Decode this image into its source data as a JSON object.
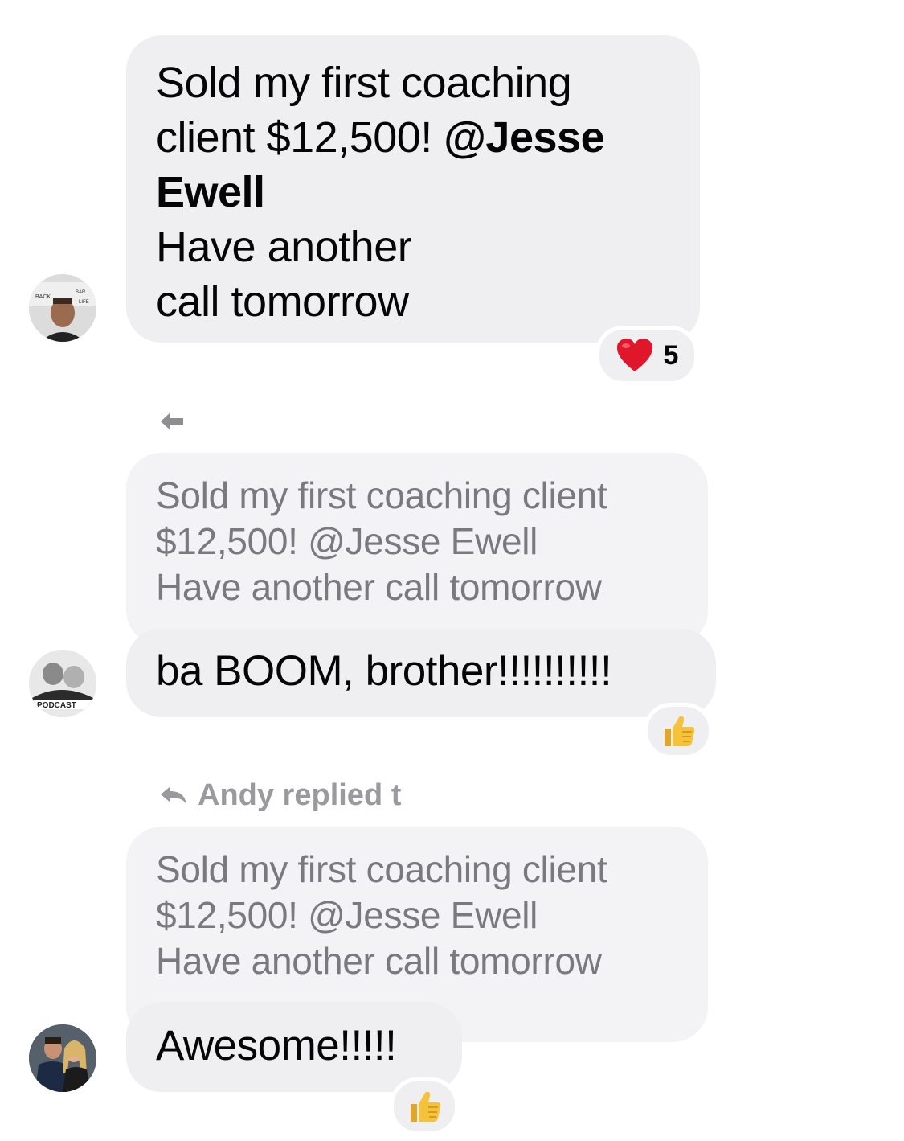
{
  "messages": [
    {
      "line1": "Sold my first coaching",
      "line2_pre": "client $12,500! ",
      "mention_part1": "@Jesse",
      "mention_part2": "Ewell",
      "line4": "Have another",
      "line5": "call tomorrow",
      "reaction_count": "5"
    },
    {
      "quote_line1": "Sold my first coaching client",
      "quote_line2": "$12,500! @Jesse Ewell",
      "quote_line3": "Have another call tomorrow",
      "text": "ba BOOM, brother!!!!!!!!!!"
    },
    {
      "reply_label": "Andy replied t",
      "quote_line1": "Sold my first coaching client",
      "quote_line2": "$12,500! @Jesse Ewell",
      "quote_line3": "Have another call tomorrow",
      "text": "Awesome!!!!!"
    }
  ],
  "avatars": [
    {
      "name": "avatar-1",
      "colors": [
        "#c9c9c9",
        "#7a5a44",
        "#2a2a2a"
      ]
    },
    {
      "name": "avatar-2",
      "badge": "PODCAST"
    },
    {
      "name": "avatar-3"
    }
  ],
  "reactions": [
    "heart-icon",
    "thumbs-up-icon",
    "thumbs-up-icon"
  ],
  "colors": {
    "bubble": "#efeff1",
    "text": "#050505",
    "quote": "#7a7a7e",
    "heart": "#e0162b",
    "thumb": "#f5c33b"
  }
}
